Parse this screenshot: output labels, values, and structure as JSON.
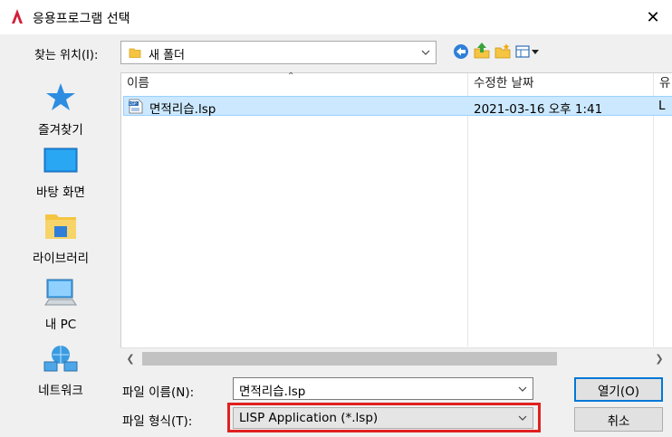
{
  "window": {
    "title": "응용프로그램 선택",
    "close_glyph": "✕"
  },
  "location": {
    "label": "찾는 위치(I):",
    "value": "새 폴더"
  },
  "places": [
    {
      "label": "즐겨찾기",
      "icon": "star-icon"
    },
    {
      "label": "바탕 화면",
      "icon": "desktop-icon"
    },
    {
      "label": "라이브러리",
      "icon": "library-icon"
    },
    {
      "label": "내 PC",
      "icon": "computer-icon"
    },
    {
      "label": "네트워크",
      "icon": "network-icon"
    }
  ],
  "columns": {
    "name": "이름",
    "date": "수정한 날짜",
    "type": "유"
  },
  "files": [
    {
      "name": "면적리습.lsp",
      "date": "2021-03-16 오후 1:41",
      "type": "L",
      "icon_text": "LSP"
    }
  ],
  "filename": {
    "label": "파일 이름(N):",
    "value": "면적리습.lsp"
  },
  "filetype": {
    "label": "파일 형식(T):",
    "value": "LISP Application (*.lsp)"
  },
  "buttons": {
    "open": "열기(O)",
    "cancel": "취소"
  },
  "colors": {
    "selection": "#cce8ff",
    "highlight_box": "#e02020",
    "default_button_border": "#0078d7"
  }
}
